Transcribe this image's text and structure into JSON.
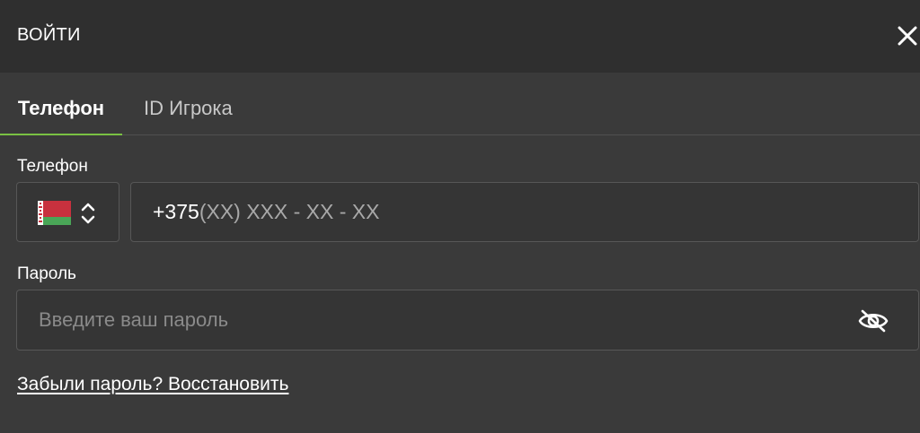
{
  "header": {
    "title": "ВОЙТИ",
    "close_icon": "close-icon"
  },
  "tabs": [
    {
      "label": "Телефон",
      "active": true
    },
    {
      "label": "ID Игрока",
      "active": false
    }
  ],
  "phone": {
    "label": "Телефон",
    "country_flag": "belarus-flag-icon",
    "country_selector_icon": "chevron-updown-icon",
    "prefix": "+375",
    "mask": "(XX) XXX - XX - XX"
  },
  "password": {
    "label": "Пароль",
    "placeholder": "Введите ваш пароль",
    "toggle_icon": "eye-hidden-icon"
  },
  "forgot": {
    "label": "Забыли пароль? Восстановить"
  },
  "colors": {
    "header_bg": "#2f2f2f",
    "body_bg": "#3a3a3a",
    "accent": "#7ac143",
    "flag_red": "#c8313e",
    "flag_green": "#4aa657"
  }
}
